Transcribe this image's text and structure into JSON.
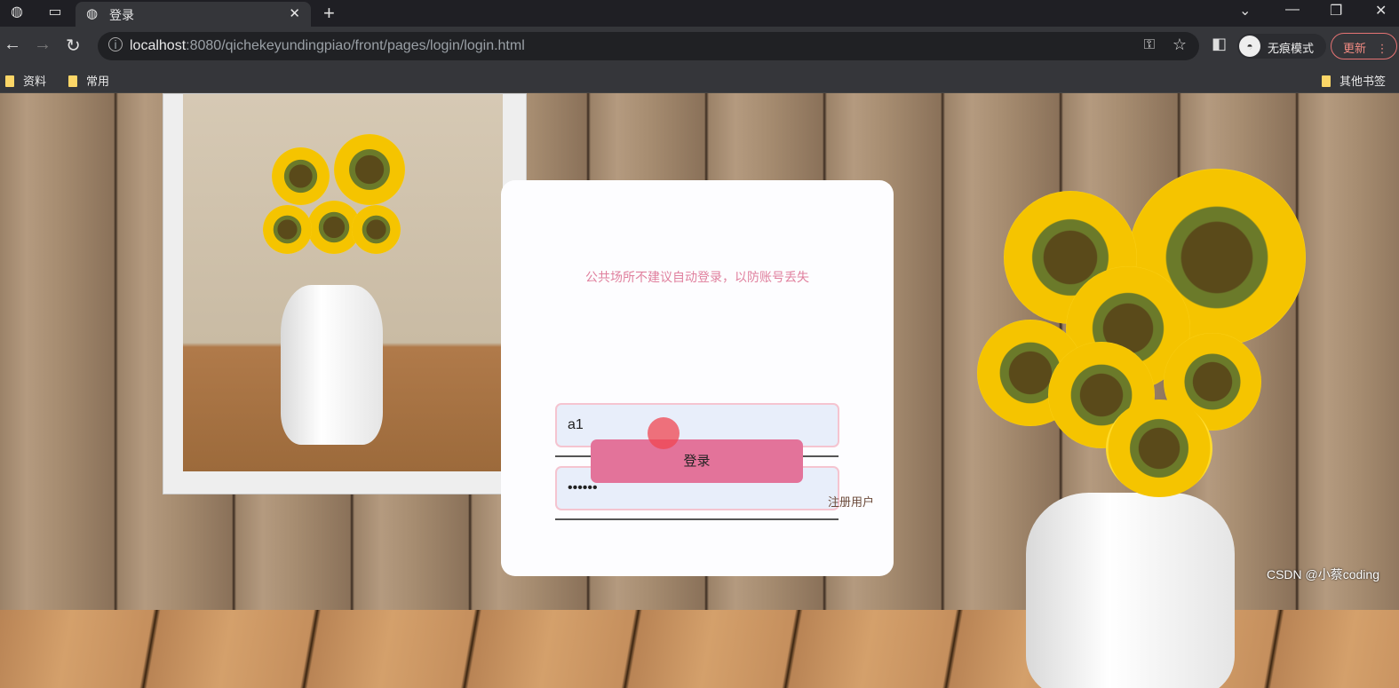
{
  "browser": {
    "tab_title": "登录",
    "url_host": "localhost",
    "url_rest": ":8080/qichekeyundingpiao/front/pages/login/login.html",
    "incognito_label": "无痕模式",
    "update_label": "更新",
    "bookmarks": [
      "资料",
      "常用"
    ],
    "other_bookmarks": "其他书签"
  },
  "login": {
    "notice": "公共场所不建议自动登录，以防账号丢失",
    "username_value": "a1",
    "password_value": "••••••",
    "login_button": "登录",
    "register_link": "注册用户"
  },
  "watermark": "CSDN @小蔡coding"
}
